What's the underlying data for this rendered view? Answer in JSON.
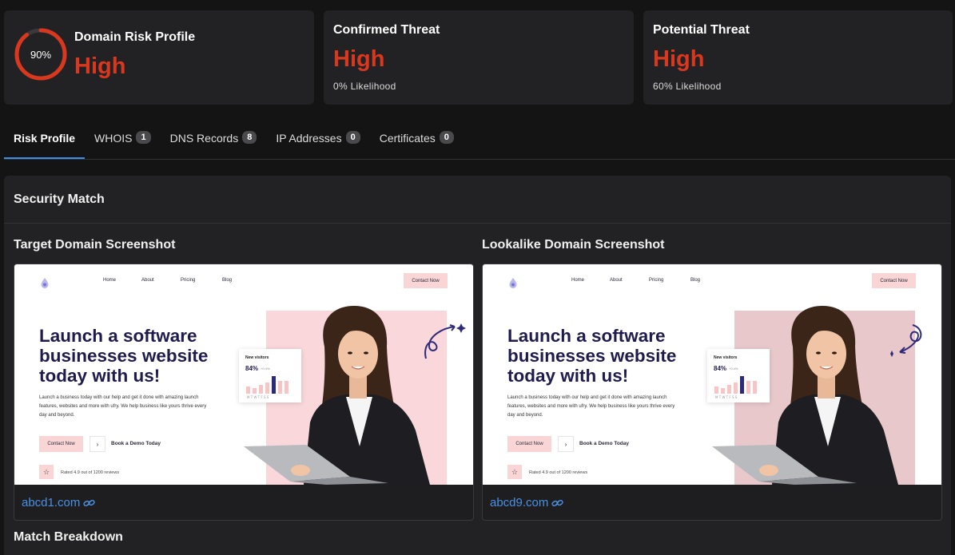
{
  "cards": {
    "domain_risk": {
      "ring_percent": 90,
      "ring_label": "90%",
      "title": "Domain Risk Profile",
      "level": "High"
    },
    "confirmed": {
      "title": "Confirmed Threat",
      "level": "High",
      "sub": "0% Likelihood"
    },
    "potential": {
      "title": "Potential Threat",
      "level": "High",
      "sub": "60% Likelihood"
    }
  },
  "colors": {
    "accent": "#3d8fe6",
    "danger": "#d9381e",
    "link": "#4a90e2"
  },
  "tabs": [
    {
      "label": "Risk Profile",
      "active": true
    },
    {
      "label": "WHOIS",
      "badge": "1"
    },
    {
      "label": "DNS Records",
      "badge": "8"
    },
    {
      "label": "IP Addresses",
      "badge": "0"
    },
    {
      "label": "Certificates",
      "badge": "0"
    }
  ],
  "panel": {
    "title": "Security Match",
    "target": {
      "title": "Target Domain Screenshot",
      "domain": "abcd1.com"
    },
    "lookalike": {
      "title": "Lookalike Domain Screenshot",
      "domain": "abcd9.com"
    },
    "match_breakdown": "Match Breakdown"
  },
  "site": {
    "nav": [
      "Home",
      "About",
      "Pricing",
      "Blog"
    ],
    "cta": "Contact Now",
    "headline": "Launch a software businesses website today with us!",
    "body": "Launch a business today with our help and get it done with amazing launch features, websites and more with ufry. We help business like yours thrive every day and beyond.",
    "button1": "Contact Now",
    "button2": "Book a Demo Today",
    "rated": "Rated 4.9 out of 1200 reviews",
    "card_title": "New visitors",
    "card_value": "84%",
    "card_delta": "+0.4%"
  },
  "icons": {
    "link": "link-icon",
    "star": "star-icon",
    "logo": "drop-logo-icon"
  }
}
